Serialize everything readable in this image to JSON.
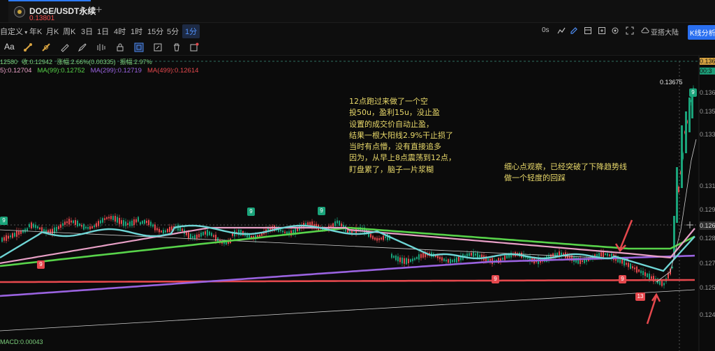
{
  "tab": {
    "symbol": "DOGE/USDT永续",
    "price": "0.13801",
    "add_icon": "plus-icon"
  },
  "toolbar": {
    "custom_label": "自定义",
    "timeframes": [
      "年K",
      "月K",
      "周K",
      "3日",
      "1日",
      "4时",
      "1时",
      "15分",
      "5分",
      "1分"
    ],
    "active_timeframe": "1分",
    "zoom": "0s",
    "region": "亚搭大陆",
    "kline_button": "K线分析",
    "aa_label": "Aa"
  },
  "info_line1": [
    "12580",
    "收:0.12942",
    "涨幅:2.66%(0.00335)",
    "振幅:2.97%"
  ],
  "ma_labels": [
    {
      "text": "5):0.12704",
      "color": "#e8a0c6"
    },
    {
      "text": "MA(99):0.12752",
      "color": "#58d34a"
    },
    {
      "text": "MA(299):0.12719",
      "color": "#9a63e0"
    },
    {
      "text": "MA(499):0.12614",
      "color": "#e5484d"
    }
  ],
  "annotation_1": "12点跑过来做了一个空\n投50u，盈利15u，没止盈\n设置的成交价自动止盈，\n结果一根大阳线2.9%干止损了\n当时有点懵，没有直接追多\n因为，从早上8点震荡到12点，\n盯盘累了，脑子一片浆糊",
  "annotation_2": "细心点观察，已经突破了下降趋势线\n做一个轻度的回踩",
  "high_label": "0.13675",
  "macd_label": "MACD:0.00043",
  "y_axis": {
    "labels": [
      "0.138",
      "0.136",
      "0.135",
      "0.133",
      "0.131",
      "0.129",
      "0.128",
      "0.127",
      "0.125",
      "0.124"
    ],
    "current": "0.126",
    "top_badge": "0.136",
    "top_badge2": "00:3"
  },
  "markers": [
    {
      "text": "9",
      "kind": "g"
    },
    {
      "text": "9",
      "kind": "r"
    },
    {
      "text": "9",
      "kind": "g"
    },
    {
      "text": "9",
      "kind": "g"
    },
    {
      "text": "9",
      "kind": "r"
    },
    {
      "text": "9",
      "kind": "r"
    },
    {
      "text": "13",
      "kind": "r"
    },
    {
      "text": "9",
      "kind": "g"
    }
  ],
  "colors": {
    "up": "#1aa37a",
    "down": "#e5484d",
    "ma7": "#6fd6d6",
    "ma25": "#e8a0c6",
    "ma99": "#58d34a",
    "ma299": "#9a63e0",
    "ma499": "#e5484d",
    "annotation": "#e8d86a",
    "accent": "#2a6ff0"
  }
}
